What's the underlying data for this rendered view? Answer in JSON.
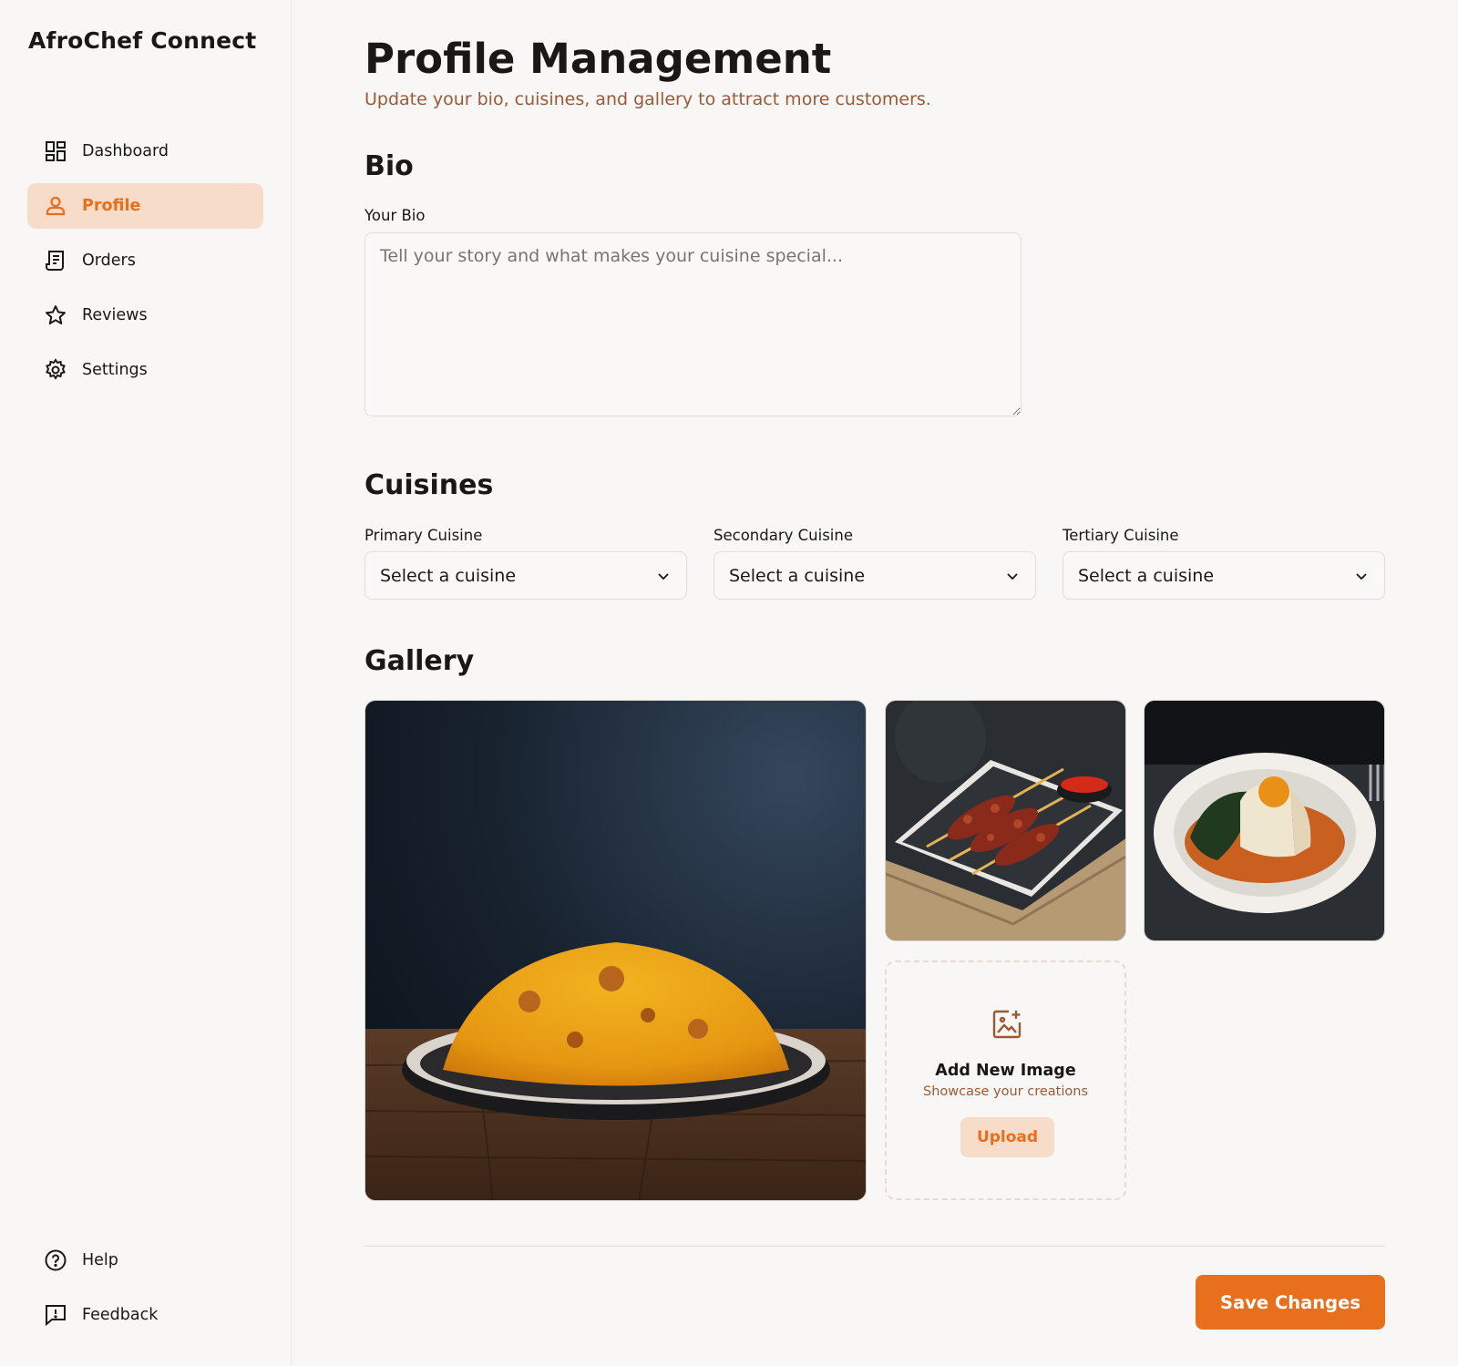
{
  "brand": "AfroChef Connect",
  "nav": {
    "items": [
      {
        "label": "Dashboard",
        "icon": "dashboard-icon"
      },
      {
        "label": "Profile",
        "icon": "person-icon",
        "active": true
      },
      {
        "label": "Orders",
        "icon": "receipt-icon"
      },
      {
        "label": "Reviews",
        "icon": "star-icon"
      },
      {
        "label": "Settings",
        "icon": "gear-icon"
      }
    ],
    "bottom": [
      {
        "label": "Help",
        "icon": "help-icon"
      },
      {
        "label": "Feedback",
        "icon": "feedback-icon"
      }
    ]
  },
  "page": {
    "title": "Profile Management",
    "subtitle": "Update your bio, cuisines, and gallery to attract more customers."
  },
  "bio": {
    "section_title": "Bio",
    "label": "Your Bio",
    "placeholder": "Tell your story and what makes your cuisine special...",
    "value": ""
  },
  "cuisines": {
    "section_title": "Cuisines",
    "fields": [
      {
        "label": "Primary Cuisine",
        "value": "Select a cuisine"
      },
      {
        "label": "Secondary Cuisine",
        "value": "Select a cuisine"
      },
      {
        "label": "Tertiary Cuisine",
        "value": "Select a cuisine"
      }
    ]
  },
  "gallery": {
    "section_title": "Gallery",
    "photos": [
      "jollof-rice-photo",
      "suya-skewers-photo",
      "pounded-yam-egusi-photo"
    ],
    "upload": {
      "title": "Add New Image",
      "subtitle": "Showcase your creations",
      "button": "Upload",
      "icon": "add-image-icon"
    }
  },
  "actions": {
    "save": "Save Changes"
  },
  "colors": {
    "accent": "#e8701d",
    "accent_soft": "#f7dcca",
    "muted_text": "#9a5a36",
    "background": "#f9f7f5"
  }
}
